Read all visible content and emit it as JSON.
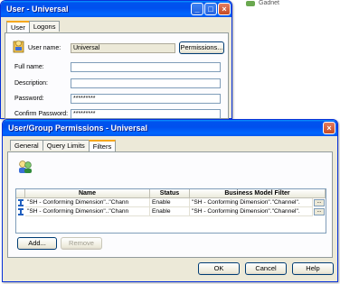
{
  "background": {
    "status_text": "Gadnet"
  },
  "user_window": {
    "title": "User - Universal",
    "tabs": [
      {
        "label": "User",
        "active": true
      },
      {
        "label": "Logons",
        "active": false
      }
    ],
    "fields": {
      "user_name_label": "User name:",
      "user_name_value": "Universal",
      "full_name_label": "Full name:",
      "full_name_value": "",
      "description_label": "Description:",
      "description_value": "",
      "password_label": "Password:",
      "password_value": "*********",
      "confirm_password_label": "Confirm Password:",
      "confirm_password_value": "*********"
    },
    "permissions_button": "Permissions...",
    "title_buttons": [
      "minimize",
      "maximize",
      "close"
    ]
  },
  "permissions_dialog": {
    "title": "User/Group Permissions - Universal",
    "tabs": [
      {
        "label": "General",
        "active": false
      },
      {
        "label": "Query Limits",
        "active": false
      },
      {
        "label": "Filters",
        "active": true
      }
    ],
    "grid": {
      "columns": [
        "Name",
        "Status",
        "Business Model Filter"
      ],
      "rows": [
        {
          "name": "\"SH - Conforming Dimension\"..\"Chann",
          "status": "Enable",
          "filter": "\"SH - Conforming Dimension\".\"Channel\".",
          "ellipsis": "..."
        },
        {
          "name": "\"SH - Conforming Dimension\"..\"Chann",
          "status": "Enable",
          "filter": "\"SH - Conforming Dimension\".\"Channel\".",
          "ellipsis": "..."
        }
      ]
    },
    "add_button": "Add...",
    "remove_button": "Remove",
    "ok_button": "OK",
    "cancel_button": "Cancel",
    "help_button": "Help",
    "close_button": "X"
  },
  "colors": {
    "title_blue": "#0053ee",
    "window_bg": "#ece9d8",
    "tab_accent": "#f6a81e",
    "border_blue": "#7f9db9"
  }
}
